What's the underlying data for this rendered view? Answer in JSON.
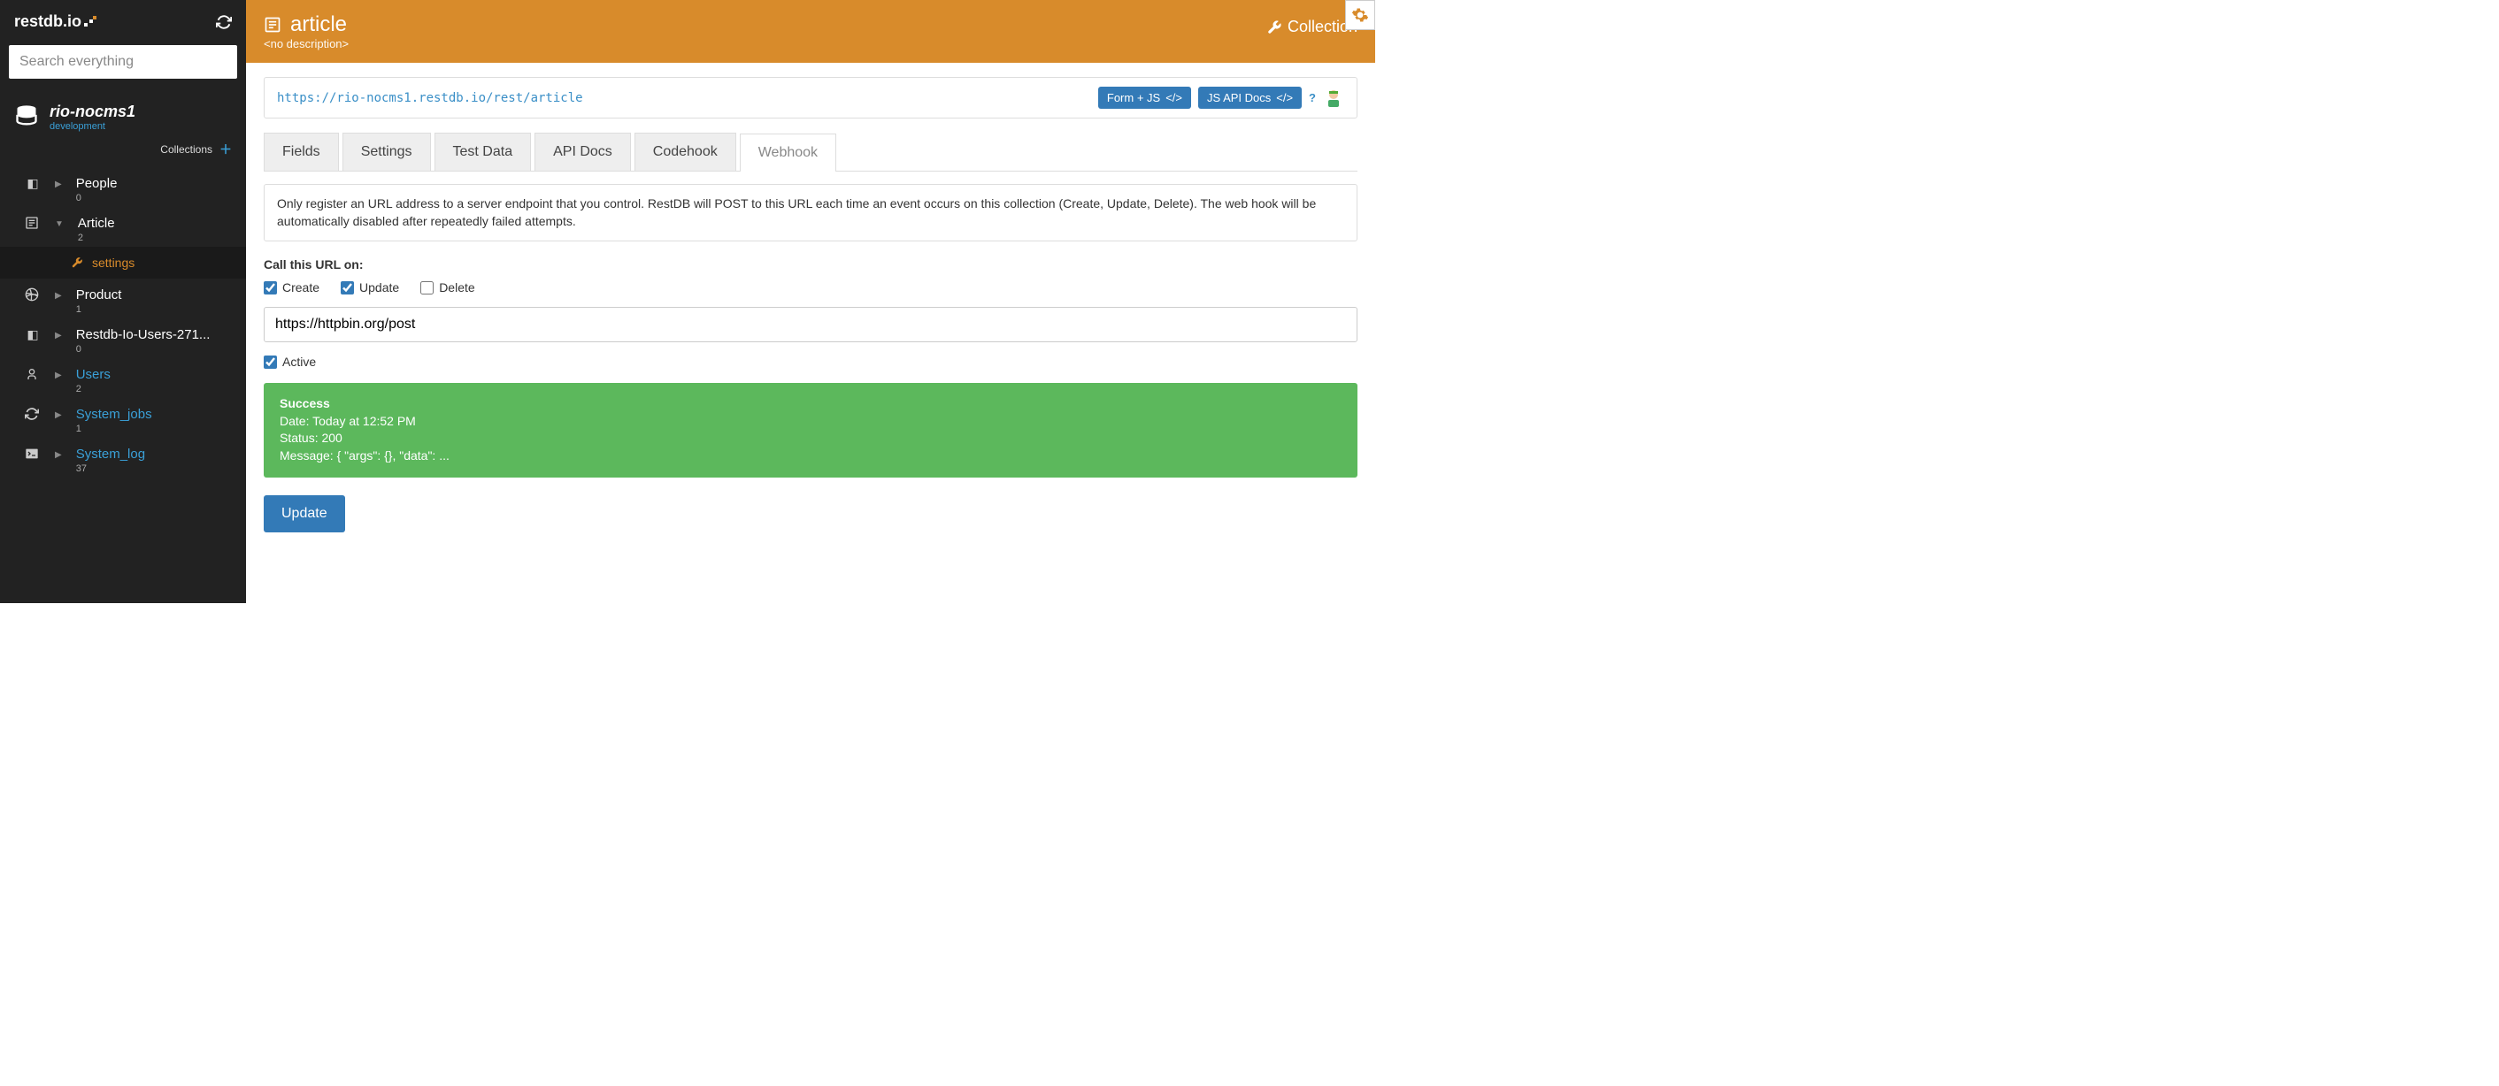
{
  "brand": "restdb.io",
  "search": {
    "placeholder": "Search everything"
  },
  "db": {
    "name": "rio-nocms1",
    "env": "development"
  },
  "sidebar": {
    "collections_label": "Collections",
    "items": [
      {
        "label": "People",
        "count": "0",
        "link": false,
        "expanded": false
      },
      {
        "label": "Article",
        "count": "2",
        "link": false,
        "expanded": true
      },
      {
        "label": "Product",
        "count": "1",
        "link": false,
        "expanded": false
      },
      {
        "label": "Restdb-Io-Users-271...",
        "count": "0",
        "link": false,
        "expanded": false
      },
      {
        "label": "Users",
        "count": "2",
        "link": true,
        "expanded": false
      },
      {
        "label": "System_jobs",
        "count": "1",
        "link": true,
        "expanded": false
      },
      {
        "label": "System_log",
        "count": "37",
        "link": true,
        "expanded": false
      }
    ],
    "settings_label": "settings"
  },
  "header": {
    "title": "article",
    "description": "<no description>",
    "right_label": "Collection"
  },
  "api": {
    "url": "https://rio-nocms1.restdb.io/rest/article",
    "btn_form": "Form + JS",
    "btn_docs": "JS API Docs"
  },
  "tabs": [
    "Fields",
    "Settings",
    "Test Data",
    "API Docs",
    "Codehook",
    "Webhook"
  ],
  "active_tab": "Webhook",
  "info_text": "Only register an URL address to a server endpoint that you control. RestDB will POST to this URL each time an event occurs on this collection (Create, Update, Delete). The web hook will be automatically disabled after repeatedly failed attempts.",
  "webhook": {
    "call_label": "Call this URL on:",
    "events": {
      "create": {
        "label": "Create",
        "checked": true
      },
      "update": {
        "label": "Update",
        "checked": true
      },
      "delete": {
        "label": "Delete",
        "checked": false
      }
    },
    "url_value": "https://httpbin.org/post",
    "active": {
      "label": "Active",
      "checked": true
    },
    "success": {
      "title": "Success",
      "date": "Date: Today at 12:52 PM",
      "status": "Status: 200",
      "message": "Message: { \"args\": {}, \"data\": ..."
    },
    "update_btn": "Update"
  }
}
